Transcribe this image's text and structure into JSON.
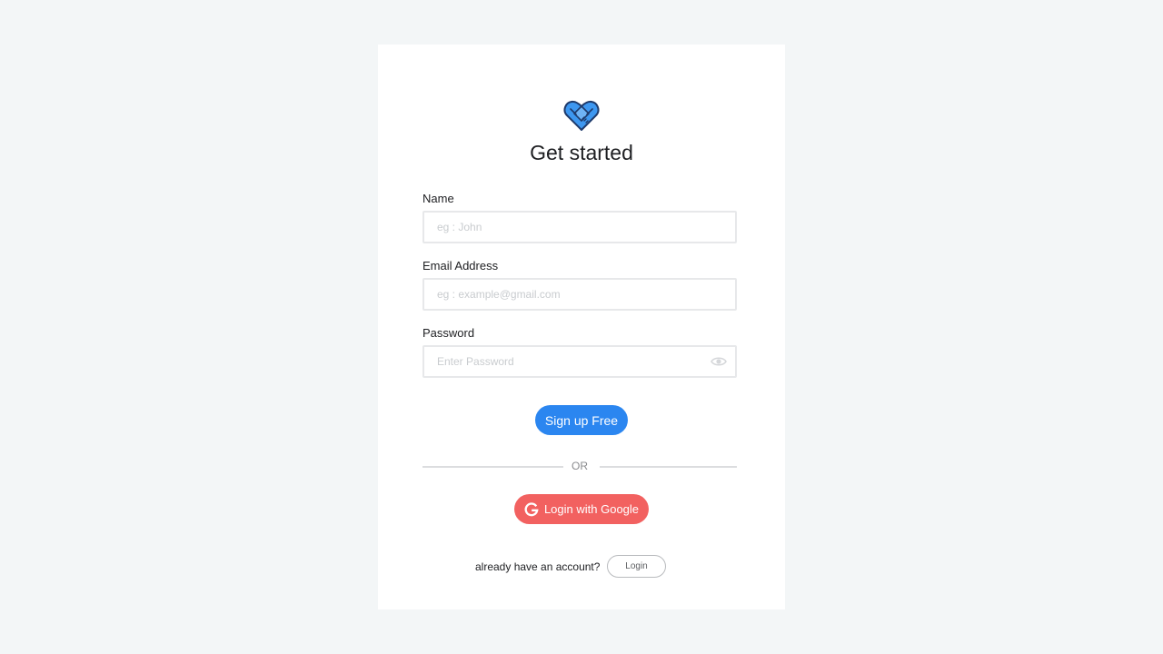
{
  "title": "Get started",
  "logo_icon": "handshake-heart-icon",
  "form": {
    "name": {
      "label": "Name",
      "value": "",
      "placeholder": "eg : John"
    },
    "email": {
      "label": "Email Address",
      "value": "",
      "placeholder": "eg : example@gmail.com"
    },
    "password": {
      "label": "Password",
      "value": "",
      "placeholder": "Enter Password",
      "toggle_icon": "eye-icon"
    }
  },
  "signup_button": "Sign up Free",
  "divider_text": "OR",
  "google_button": {
    "label": "Login with Google",
    "icon": "google-icon"
  },
  "account_prompt": "already have an account?",
  "login_button": "Login",
  "colors": {
    "background": "#f3f6f7",
    "primary": "#2b86f0",
    "google": "#f26160",
    "logo_blue": "#3d97f0",
    "logo_dark": "#1e3a6b"
  }
}
